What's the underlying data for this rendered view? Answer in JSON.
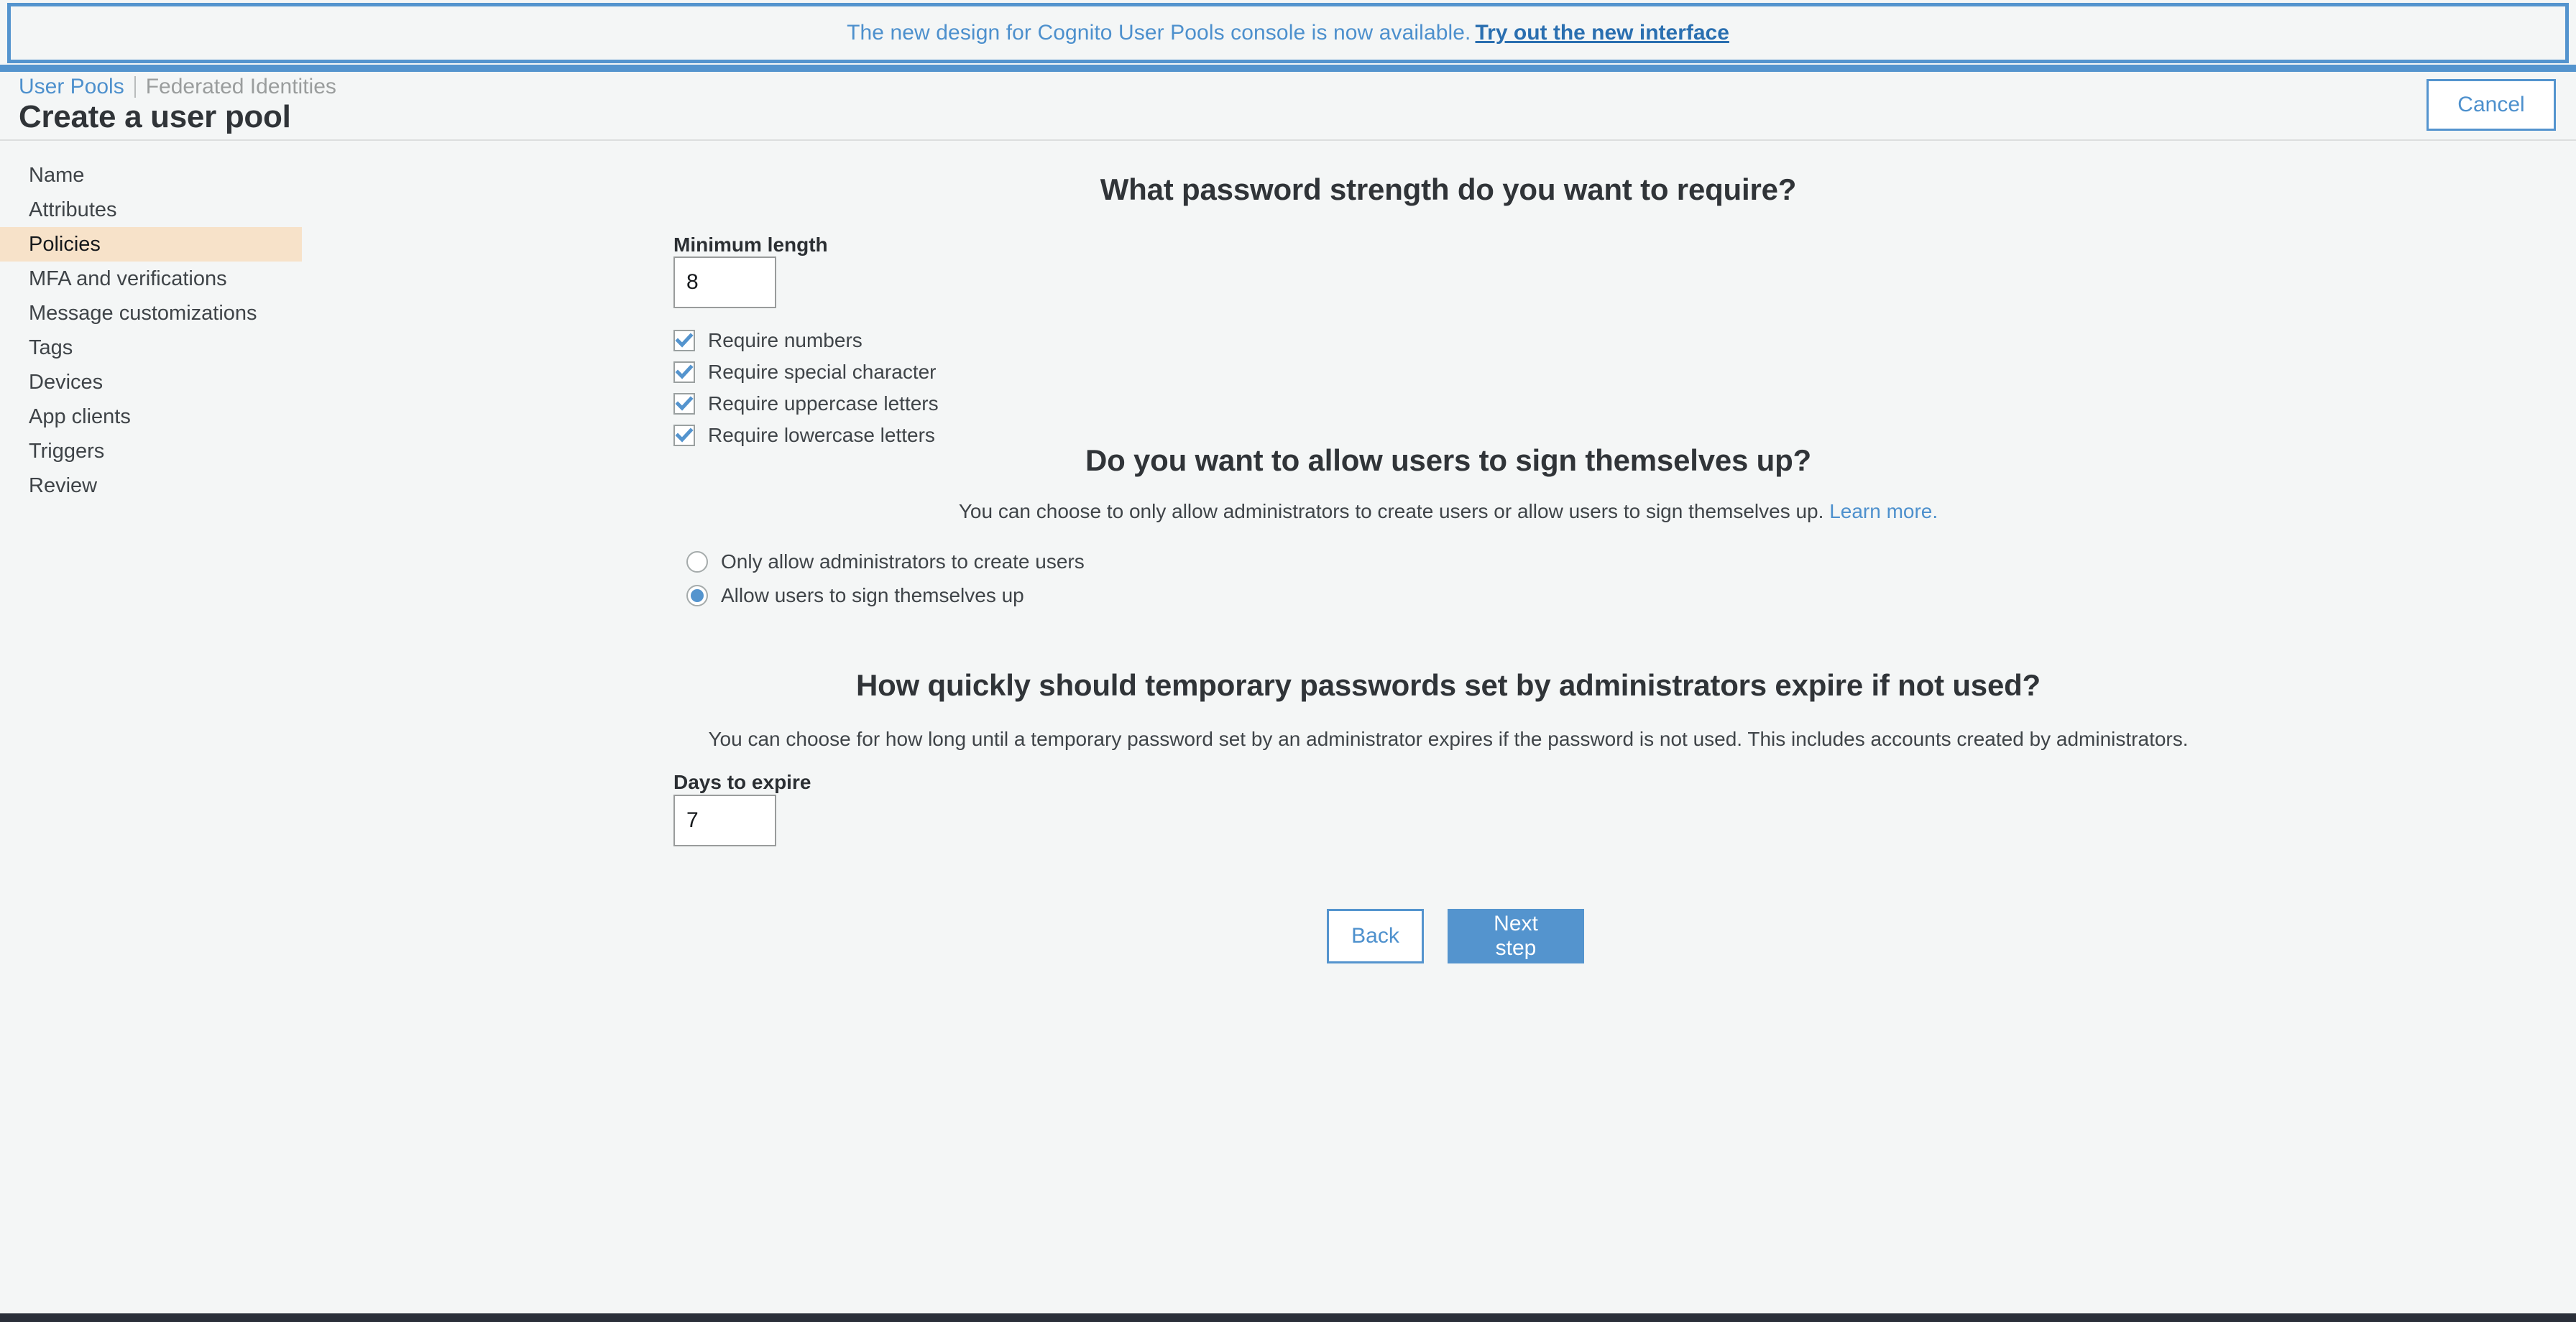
{
  "banner": {
    "message": "The new design for Cognito User Pools console is now available.",
    "link_label": "Try out the new interface"
  },
  "header": {
    "tab_active": "User Pools",
    "tab_inactive": "Federated Identities",
    "title": "Create a user pool",
    "cancel_label": "Cancel"
  },
  "sidebar": {
    "items": [
      {
        "label": "Name"
      },
      {
        "label": "Attributes"
      },
      {
        "label": "Policies"
      },
      {
        "label": "MFA and verifications"
      },
      {
        "label": "Message customizations"
      },
      {
        "label": "Tags"
      },
      {
        "label": "Devices"
      },
      {
        "label": "App clients"
      },
      {
        "label": "Triggers"
      },
      {
        "label": "Review"
      }
    ],
    "active_label": "Policies"
  },
  "password_strength": {
    "heading": "What password strength do you want to require?",
    "min_length_label": "Minimum length",
    "min_length_value": "8",
    "requirements": [
      {
        "label": "Require numbers",
        "checked": true
      },
      {
        "label": "Require special character",
        "checked": true
      },
      {
        "label": "Require uppercase letters",
        "checked": true
      },
      {
        "label": "Require lowercase letters",
        "checked": true
      }
    ]
  },
  "signup": {
    "heading": "Do you want to allow users to sign themselves up?",
    "description": "You can choose to only allow administrators to create users or allow users to sign themselves up.",
    "learn_more": "Learn more.",
    "options": [
      {
        "label": "Only allow administrators to create users",
        "selected": false
      },
      {
        "label": "Allow users to sign themselves up",
        "selected": true
      }
    ]
  },
  "temporary_passwords": {
    "heading": "How quickly should temporary passwords set by administrators expire if not used?",
    "description": "You can choose for how long until a temporary password set by an administrator expires if the password is not used. This includes accounts created by administrators.",
    "days_label": "Days to expire",
    "days_value": "7"
  },
  "footer": {
    "back_label": "Back",
    "next_label": "Next step"
  },
  "colors": {
    "accent_blue": "#5494ce",
    "link_blue": "#4d90cd",
    "active_nav_bg": "#f7e2c9",
    "page_bg": "#f4f6f6"
  }
}
